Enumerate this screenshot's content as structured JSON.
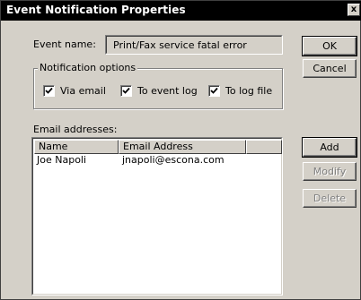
{
  "window": {
    "title": "Event Notification Properties",
    "close_glyph": "x"
  },
  "event": {
    "label": "Event name:",
    "value": "Print/Fax service fatal error"
  },
  "notification": {
    "legend": "Notification options",
    "options": [
      {
        "label": "Via email",
        "checked": true
      },
      {
        "label": "To event log",
        "checked": true
      },
      {
        "label": "To log file",
        "checked": true
      }
    ]
  },
  "email": {
    "label": "Email addresses:",
    "columns": [
      "Name",
      "Email Address",
      ""
    ],
    "rows": [
      {
        "name": "Joe Napoli",
        "email": "jnapoli@escona.com"
      }
    ]
  },
  "buttons": {
    "ok": "OK",
    "cancel": "Cancel",
    "add": "Add",
    "modify": "Modify",
    "delete": "Delete"
  }
}
